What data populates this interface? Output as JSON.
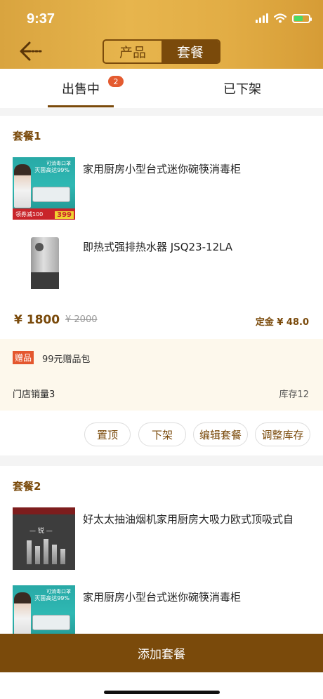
{
  "status_bar": {
    "time": "9:37",
    "icons": [
      "signal-icon",
      "wifi-icon",
      "battery-icon"
    ]
  },
  "header": {
    "back_icon": "back-arrow-icon",
    "segments": [
      "产品",
      "套餐"
    ],
    "active_segment": "套餐"
  },
  "tabs": [
    {
      "label": "出售中",
      "badge": "2"
    },
    {
      "label": "已下架"
    }
  ],
  "packages": [
    {
      "title": "套餐1",
      "products": [
        {
          "name": "家用厨房小型台式迷你碗筷消毒柜",
          "image": {
            "t1": "可消毒口罩",
            "t2": "灭菌高达99%",
            "bar": "领券减100",
            "price": "399"
          }
        },
        {
          "name": "即热式强排热水器 JSQ23-12LA"
        }
      ],
      "price": "¥ 1800",
      "original_price": "¥ 2000",
      "deposit": "定金 ¥ 48.0",
      "gift_tag": "赠品",
      "gift_text": "99元赠品包",
      "store_sales": "门店销量3",
      "stock": "库存12",
      "actions": [
        "置顶",
        "下架",
        "编辑套餐",
        "调整库存"
      ]
    },
    {
      "title": "套餐2",
      "products": [
        {
          "name": "好太太抽油烟机家用厨房大吸力欧式顶吸式自",
          "image": {
            "label": "— 锐 —"
          }
        },
        {
          "name": "家用厨房小型台式迷你碗筷消毒柜",
          "image": {
            "t1": "可消毒口罩",
            "t2": "灭菌高达99%"
          }
        }
      ]
    }
  ],
  "bottom_button": "添加套餐",
  "colors": {
    "brand_brown": "#7a4a0b",
    "header_gold": "#e2ad45",
    "badge_red": "#e45b30",
    "gift_bg": "#fdf8ec"
  }
}
